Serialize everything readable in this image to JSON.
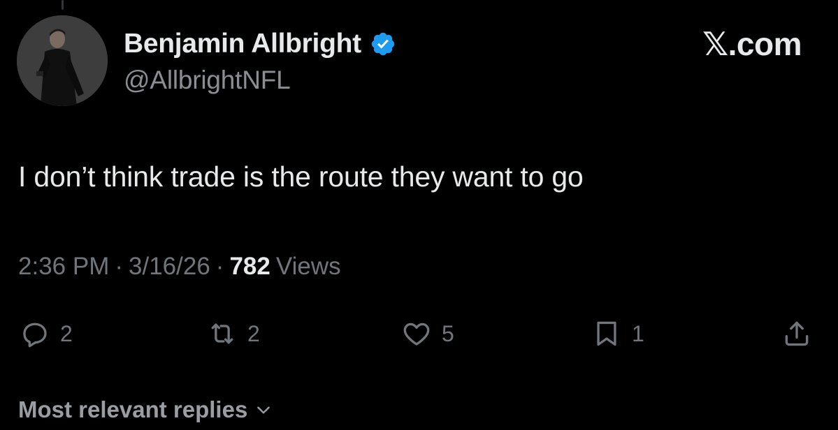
{
  "author": {
    "display_name": "Benjamin Allbright",
    "handle": "@AllbrightNFL",
    "verified": true
  },
  "brand": "𝕏.com",
  "tweet": {
    "text": "I don’t think trade is the route they want to go"
  },
  "meta": {
    "time": "2:36 PM",
    "separator": "·",
    "date": "3/16/26",
    "views_count": "782",
    "views_label": "Views"
  },
  "actions": {
    "reply": {
      "icon": "reply-icon",
      "count": "2"
    },
    "repost": {
      "icon": "repost-icon",
      "count": "2"
    },
    "like": {
      "icon": "heart-icon",
      "count": "5"
    },
    "bookmark": {
      "icon": "bookmark-icon",
      "count": "1"
    },
    "share": {
      "icon": "share-icon"
    }
  },
  "replies": {
    "label": "Most relevant replies"
  },
  "colors": {
    "background": "#000000",
    "text_primary": "#e7e9ea",
    "text_secondary": "#71767b",
    "verified": "#1d9bf0"
  }
}
